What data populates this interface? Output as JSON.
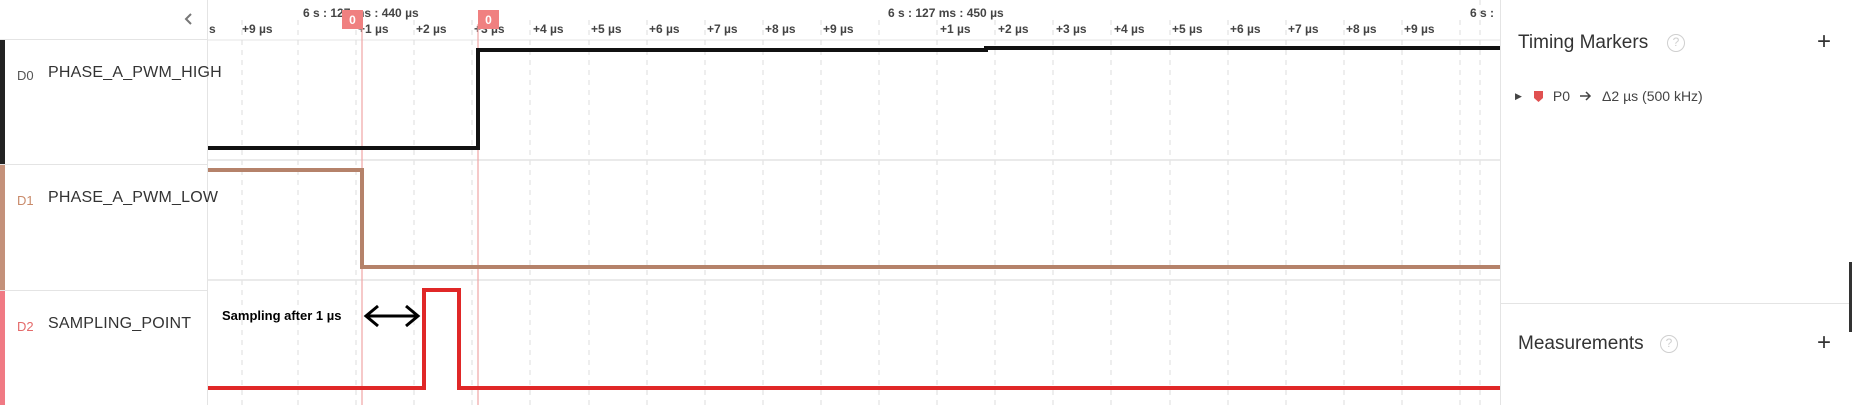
{
  "channels": [
    {
      "id": "D0",
      "name": "PHASE_A_PWM_HIGH",
      "color": "#1a1a1a",
      "id_color": "#555555"
    },
    {
      "id": "D1",
      "name": "PHASE_A_PWM_LOW",
      "color": "#b5826a",
      "id_color": "#c98a6a"
    },
    {
      "id": "D2",
      "name": "SAMPLING_POINT",
      "color": "#e02727",
      "id_color": "#e46a6a"
    }
  ],
  "timeline": {
    "group_labels": [
      "6 s : 127 ms : 440 µs",
      "6 s : 127 ms : 450 µs",
      "6 s :"
    ],
    "tick_labels": [
      "s",
      "+9 µs",
      "+1 µs",
      "+2 µs",
      "+3 µs",
      "+4 µs",
      "+5 µs",
      "+6 µs",
      "+7 µs",
      "+8 µs",
      "+9 µs",
      "+1 µs",
      "+2 µs",
      "+3 µs",
      "+4 µs",
      "+5 µs",
      "+6 µs",
      "+7 µs",
      "+8 µs",
      "+9 µs"
    ],
    "marker_labels": [
      "0",
      "0"
    ]
  },
  "annotation": {
    "text": "Sampling after 1 µs"
  },
  "side": {
    "timing_markers_title": "Timing Markers",
    "measurements_title": "Measurements",
    "help_glyph": "?",
    "add_glyph": "+",
    "marker": {
      "name": "P0",
      "delta": "Δ2 µs (500 kHz)"
    }
  },
  "icons": {
    "collapse": "chevron-left-icon",
    "expand": "caret-right-icon",
    "marker_flag": "marker-flag-icon",
    "arrow": "arrow-right-icon"
  },
  "colors": {
    "marker_line": "#f0a5a5",
    "marker_badge": "#f08080",
    "grid": "#dddddd"
  }
}
